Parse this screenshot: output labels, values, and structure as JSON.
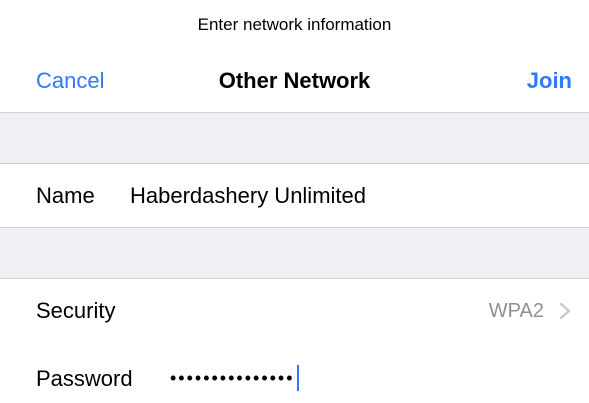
{
  "prompt": "Enter network information",
  "navbar": {
    "cancel_label": "Cancel",
    "title": "Other Network",
    "join_label": "Join"
  },
  "form": {
    "name_label": "Name",
    "name_value": "Haberdashery Unlimited",
    "security_label": "Security",
    "security_value": "WPA2",
    "password_label": "Password",
    "password_value": "•••••••••••••••"
  },
  "colors": {
    "accent": "#2f7bf6",
    "group_background": "#efeff4",
    "secondary_text": "#8e8e93"
  },
  "icons": {
    "security_disclosure": "chevron-right-icon"
  }
}
